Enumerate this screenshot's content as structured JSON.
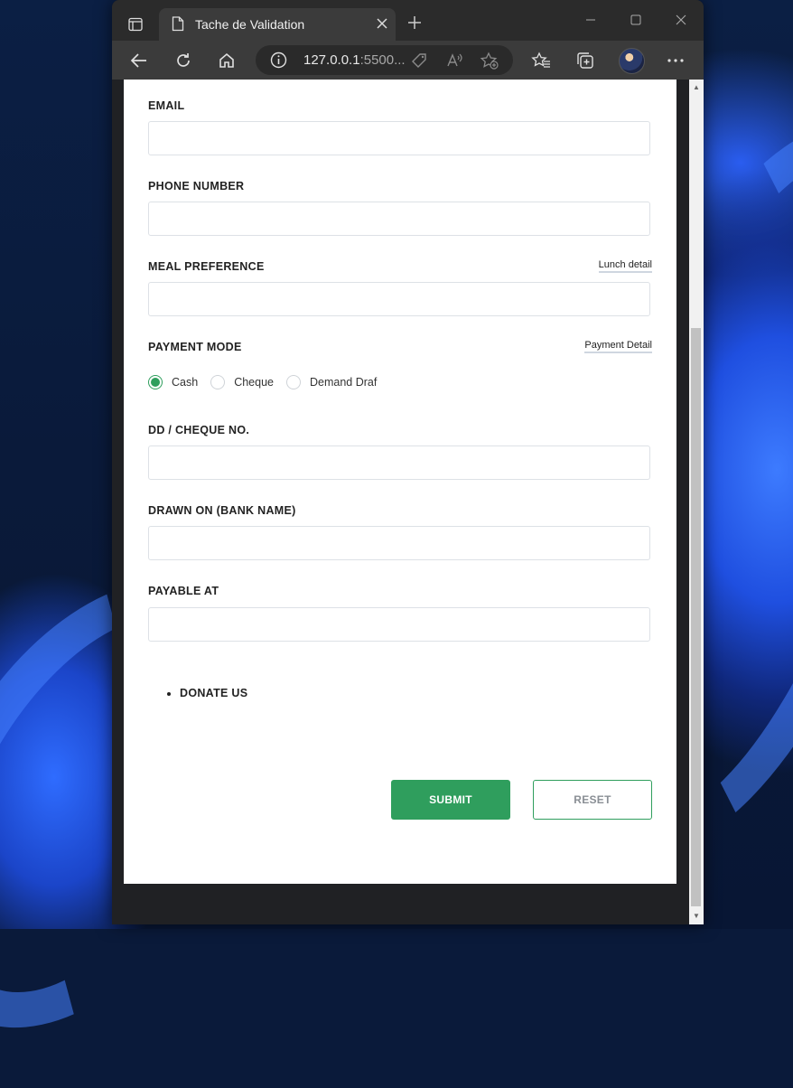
{
  "browser": {
    "tab_title": "Tache de Validation",
    "url_host": "127.0.0.1",
    "url_rest": ":5500..."
  },
  "form": {
    "email": {
      "label": "EMAIL",
      "value": ""
    },
    "phone": {
      "label": "PHONE NUMBER",
      "value": ""
    },
    "meal": {
      "label": "MEAL PREFERENCE",
      "link": "Lunch detail",
      "value": ""
    },
    "payment": {
      "label": "PAYMENT MODE",
      "link": "Payment Detail",
      "options": [
        "Cash",
        "Cheque",
        "Demand Draf"
      ],
      "selected": "Cash"
    },
    "dd_cheque": {
      "label": "DD / CHEQUE NO.",
      "value": ""
    },
    "drawn_on": {
      "label": "DRAWN ON (BANK NAME)",
      "value": ""
    },
    "payable_at": {
      "label": "PAYABLE AT",
      "value": ""
    },
    "donate": "DONATE US",
    "submit_label": "SUBMIT",
    "reset_label": "RESET"
  },
  "colors": {
    "accent": "#2f9e5d",
    "browser_chrome": "#3b3b3b",
    "tabstrip": "#2b2b2b"
  }
}
